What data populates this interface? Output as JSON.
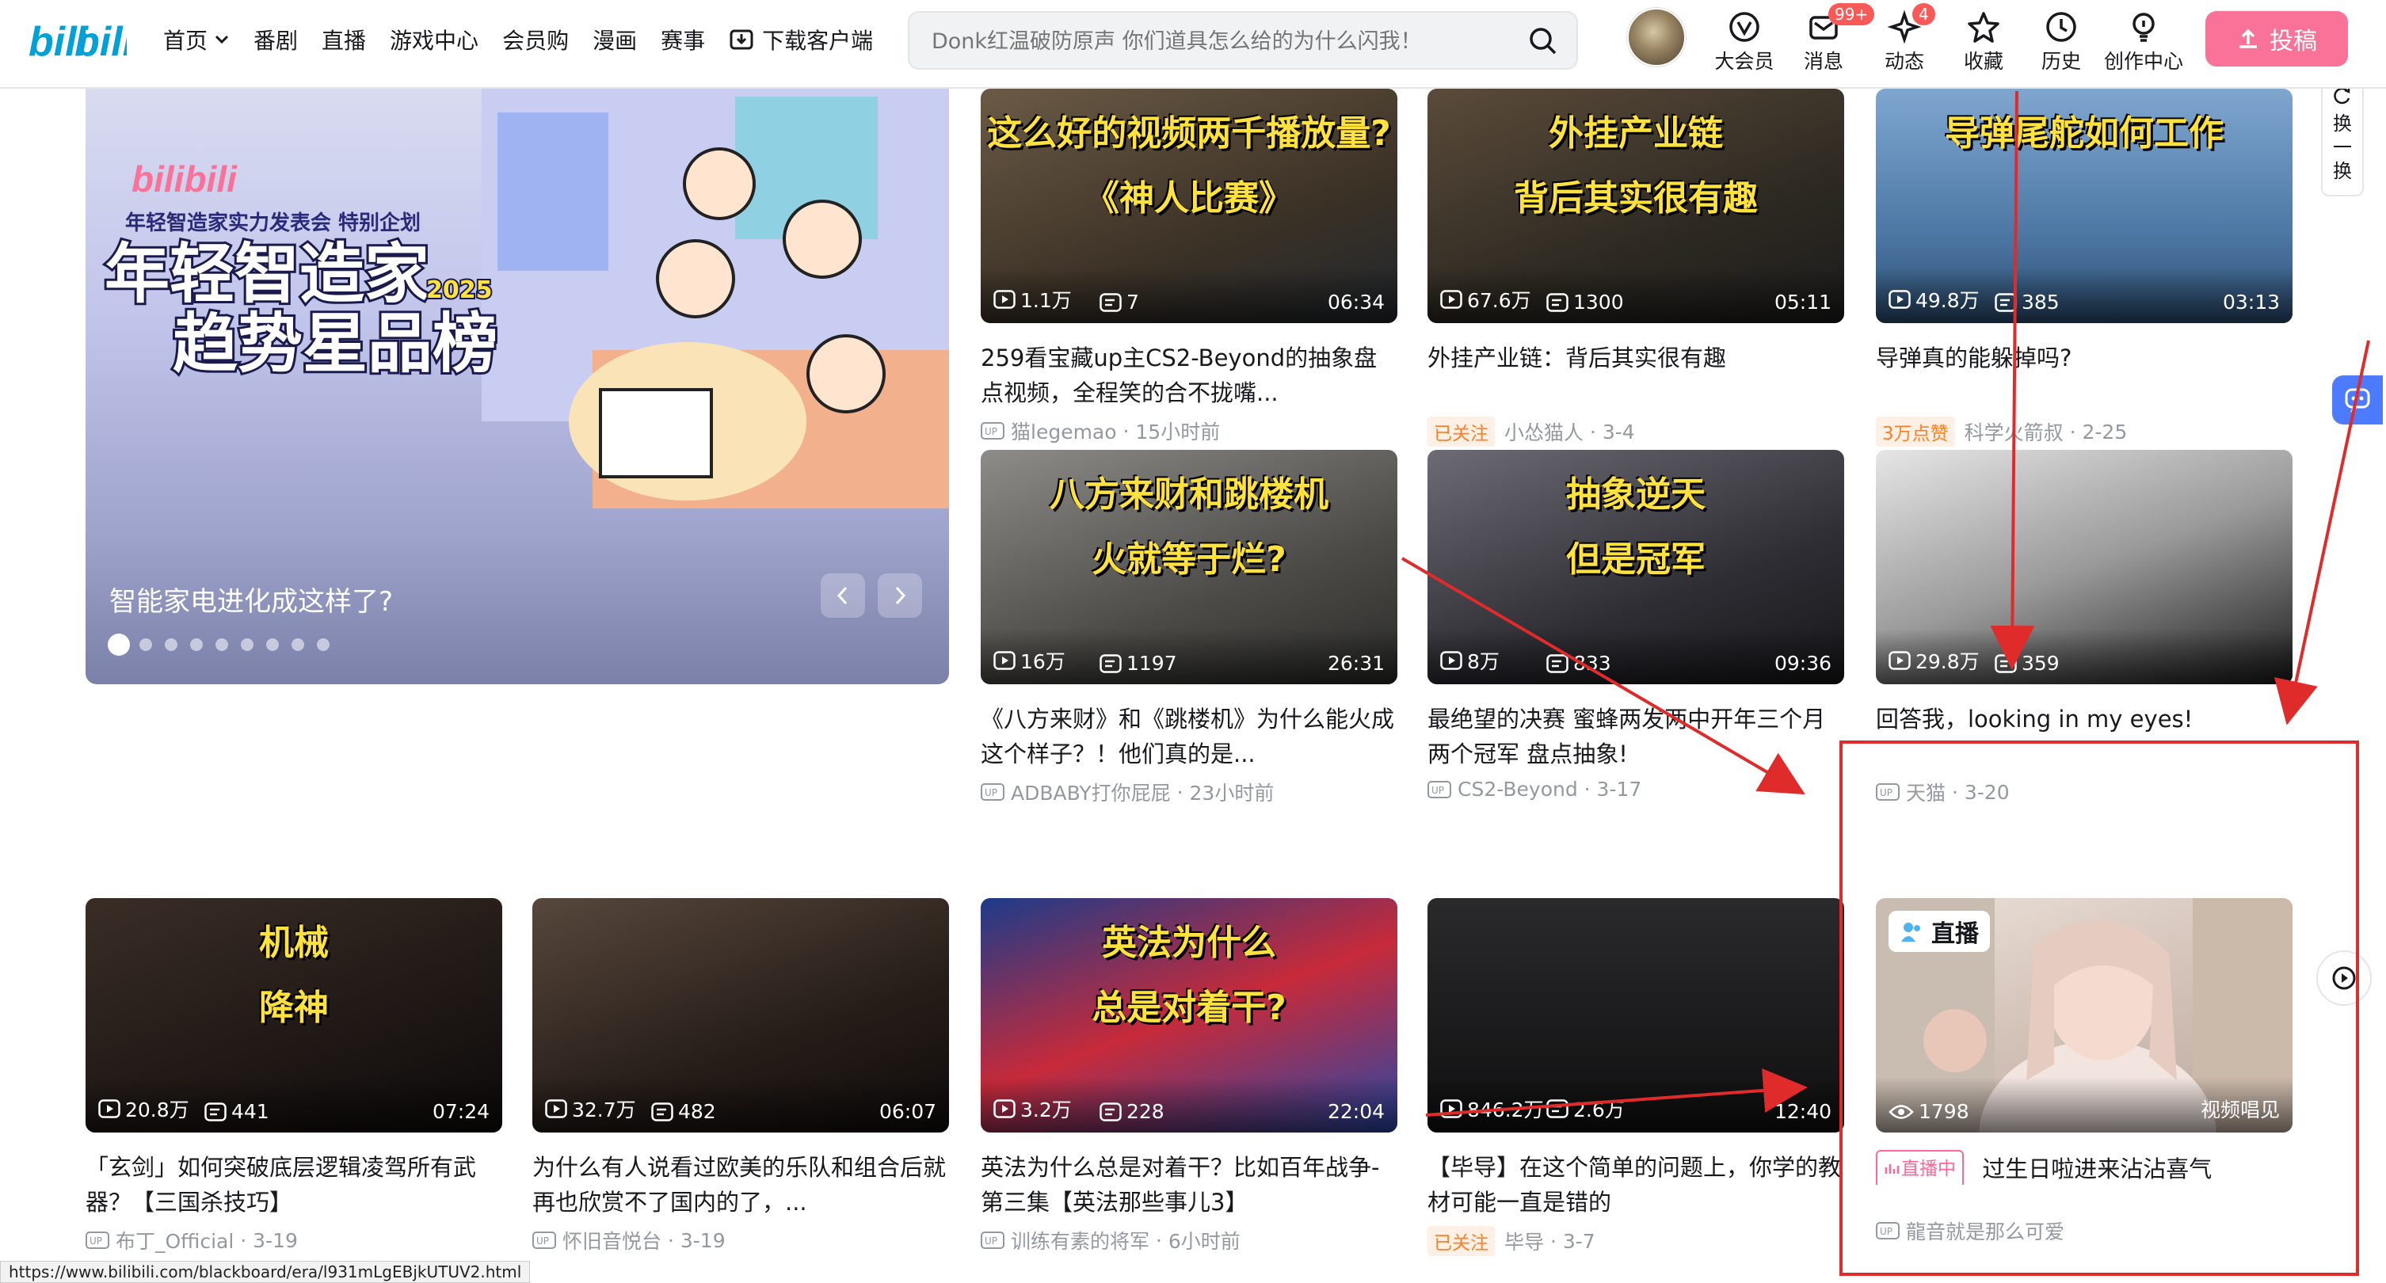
{
  "header": {
    "nav": [
      {
        "label": "首页"
      },
      {
        "label": "番剧"
      },
      {
        "label": "直播"
      },
      {
        "label": "游戏中心"
      },
      {
        "label": "会员购"
      },
      {
        "label": "漫画"
      },
      {
        "label": "赛事"
      },
      {
        "label": "下载客户端"
      }
    ],
    "search_placeholder": "Donk红温破防原声 你们道具怎么给的为什么闪我！",
    "buttons": [
      {
        "label": "大会员",
        "icon": "vip-icon"
      },
      {
        "label": "消息",
        "icon": "message-icon",
        "badge": "99+"
      },
      {
        "label": "动态",
        "icon": "dynamic-icon",
        "badge": "4"
      },
      {
        "label": "收藏",
        "icon": "star-icon"
      },
      {
        "label": "历史",
        "icon": "clock-icon"
      },
      {
        "label": "创作中心",
        "icon": "bulb-icon"
      }
    ],
    "upload_label": "投稿"
  },
  "banner": {
    "caption": "智能家电进化成这样了?",
    "art_logo": "bilibili",
    "art_subtitle": "年轻智造家实力发表会 特别企划",
    "art_title_1": "年轻智造家",
    "art_year": "2025",
    "art_title_2": "趋势星品榜",
    "dots": 9
  },
  "videos": [
    {
      "thumb_text": "这么好的视频两千播放量?",
      "thumb_text2": "《神人比赛》",
      "views": "1.1万",
      "danmaku": "7",
      "duration": "06:34",
      "title": "259看宝藏up主CS2-Beyond的抽象盘点视频，全程笑的合不拢嘴...",
      "up": "猫legemao",
      "time": "15小时前",
      "tag": ""
    },
    {
      "thumb_text": "外挂产业链",
      "thumb_text2": "背后其实很有趣",
      "views": "67.6万",
      "danmaku": "1300",
      "duration": "05:11",
      "title": "外挂产业链：背后其实很有趣",
      "up": "小怂猫人",
      "time": "3-4",
      "tag": "已关注"
    },
    {
      "thumb_text": "导弹尾舵如何工作",
      "thumb_text2": "",
      "views": "49.8万",
      "danmaku": "385",
      "duration": "03:13",
      "title": "导弹真的能躲掉吗?",
      "up": "科学火箭叔",
      "time": "2-25",
      "tag": "3万点赞"
    },
    {
      "thumb_text": "八方来财和跳楼机",
      "thumb_text2": "火就等于烂?",
      "views": "16万",
      "danmaku": "1197",
      "duration": "26:31",
      "title": "《八方来财》和《跳楼机》为什么能火成这个样子？！他们真的是...",
      "up": "ADBABY打你屁屁",
      "time": "23小时前",
      "tag": ""
    },
    {
      "thumb_text": "抽象逆天",
      "thumb_text2": "但是冠军",
      "views": "8万",
      "danmaku": "833",
      "duration": "09:36",
      "title": "最绝望的决赛 蜜蜂两发两中开年三个月两个冠军 盘点抽象!",
      "up": "CS2-Beyond",
      "time": "3-17",
      "tag": ""
    },
    {
      "thumb_text": "",
      "thumb_text2": "",
      "views": "29.8万",
      "danmaku": "359",
      "duration": "",
      "title": "回答我，looking in my eyes!",
      "up": "天猫",
      "time": "3-20",
      "tag": ""
    },
    {
      "thumb_text": "机械",
      "thumb_text2": "降神",
      "views": "20.8万",
      "danmaku": "441",
      "duration": "07:24",
      "title": "「玄剑」如何突破底层逻辑凌驾所有武器？【三国杀技巧】",
      "up": "布丁_Official",
      "time": "3-19",
      "tag": ""
    },
    {
      "thumb_text": "",
      "thumb_text2": "",
      "views": "32.7万",
      "danmaku": "482",
      "duration": "06:07",
      "title": "为什么有人说看过欧美的乐队和组合后就再也欣赏不了国内的了，...",
      "up": "怀旧音悦台",
      "time": "3-19",
      "tag": ""
    },
    {
      "thumb_text": "英法为什么",
      "thumb_text2": "总是对着干?",
      "views": "3.2万",
      "danmaku": "228",
      "duration": "22:04",
      "title": "英法为什么总是对着干？比如百年战争-第三集【英法那些事儿3】",
      "up": "训练有素的将军",
      "time": "6小时前",
      "tag": ""
    },
    {
      "thumb_text": "",
      "thumb_text2": "",
      "views": "846.2万",
      "danmaku": "2.6万",
      "duration": "12:40",
      "title": "【毕导】在这个简单的问题上，你学的教材可能一直是错的",
      "up": "毕导",
      "time": "3-7",
      "tag": "已关注"
    }
  ],
  "live": {
    "badge": "直播",
    "viewers": "1798",
    "category": "视频唱见",
    "tag": "直播中",
    "title": "过生日啦进来沾沾喜气",
    "up": "龍音就是那么可爱"
  },
  "side": {
    "refresh": [
      "换",
      "一",
      "换"
    ]
  },
  "status_url": "https://www.bilibili.com/blackboard/era/l931mLgEBjkUTUV2.html"
}
